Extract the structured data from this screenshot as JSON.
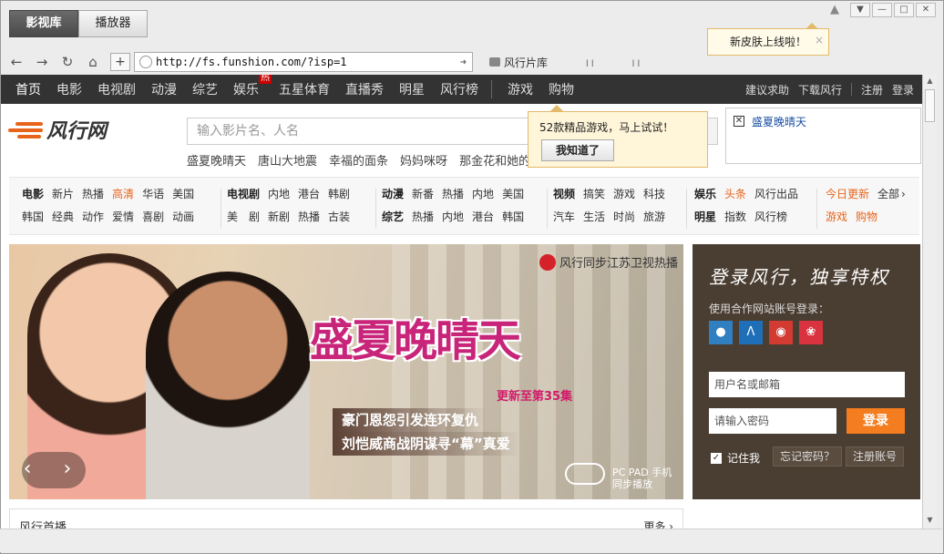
{
  "app": {
    "tabs": [
      {
        "label": "影视库"
      },
      {
        "label": "播放器"
      }
    ],
    "skin_tooltip": "新皮肤上线啦！",
    "skin_tooltip_close": "×"
  },
  "navbar": {
    "url": "http://fs.funshion.com/?isp=1",
    "bookmark": "风行片库",
    "marks": [
      "ן ן",
      "ן ן"
    ]
  },
  "site": {
    "nav": [
      "首页",
      "电影",
      "电视剧",
      "动漫",
      "综艺",
      "娱乐",
      "五星体育",
      "直播秀",
      "明星",
      "风行榜",
      "游戏",
      "购物"
    ],
    "hot_badge": "热",
    "right_links": [
      "建议求助",
      "下载风行",
      "注册",
      "登录"
    ],
    "logo": "风行网",
    "search_placeholder": "输入影片名、人名",
    "hotwords": [
      "盛夏晚晴天",
      "唐山大地震",
      "幸福的面条",
      "妈妈咪呀",
      "那金花和她的女婿"
    ],
    "game_tip": {
      "text": "52款精品游戏，马上试试！",
      "button": "我知道了"
    },
    "ad_link": "盛夏晚晴天"
  },
  "categories": {
    "col1": {
      "row1": [
        "电影",
        "新片",
        "热播",
        "高清",
        "华语",
        "美国"
      ],
      "row2": [
        "韩国",
        "经典",
        "动作",
        "爱情",
        "喜剧",
        "动画"
      ]
    },
    "col2": {
      "row1": [
        "电视剧",
        "内地",
        "港台",
        "韩剧"
      ],
      "row2": [
        "美　剧",
        "新剧",
        "热播",
        "古装"
      ]
    },
    "col3": {
      "row1": [
        "动漫",
        "新番",
        "热播",
        "内地",
        "美国"
      ],
      "row2": [
        "综艺",
        "热播",
        "内地",
        "港台",
        "韩国"
      ]
    },
    "col4": {
      "row1": [
        "视频",
        "搞笑",
        "游戏",
        "科技"
      ],
      "row2": [
        "汽车",
        "生活",
        "时尚",
        "旅游"
      ]
    },
    "col5": {
      "row1": [
        "娱乐",
        "头条",
        "风行出品"
      ],
      "row2": [
        "明星",
        "指数",
        "风行榜"
      ]
    },
    "col6": {
      "row1": [
        "今日更新",
        "全部"
      ],
      "row2": [
        "游戏",
        "购物"
      ]
    }
  },
  "banner": {
    "brand": "风行同步江苏卫视热播",
    "title": "盛夏晚晴天",
    "episode": "更新至第35集",
    "line1": "豪门恩怨引发连环复仇",
    "line2": "刘恺威商战阴谋寻“幕”真爱",
    "pcpad": "PC PAD 手机",
    "sync": "同步播放",
    "arrows": "‹ ›"
  },
  "login": {
    "heading": "登录风行，独享特权",
    "sub": "使用合作网站账号登录：",
    "username_placeholder": "用户名或邮箱",
    "password_placeholder": "请输入密码",
    "login_button": "登录",
    "remember": "记住我",
    "forgot": "忘记密码？",
    "register": "注册账号"
  },
  "section": {
    "title": "风行首播",
    "more": "更多 ›"
  }
}
